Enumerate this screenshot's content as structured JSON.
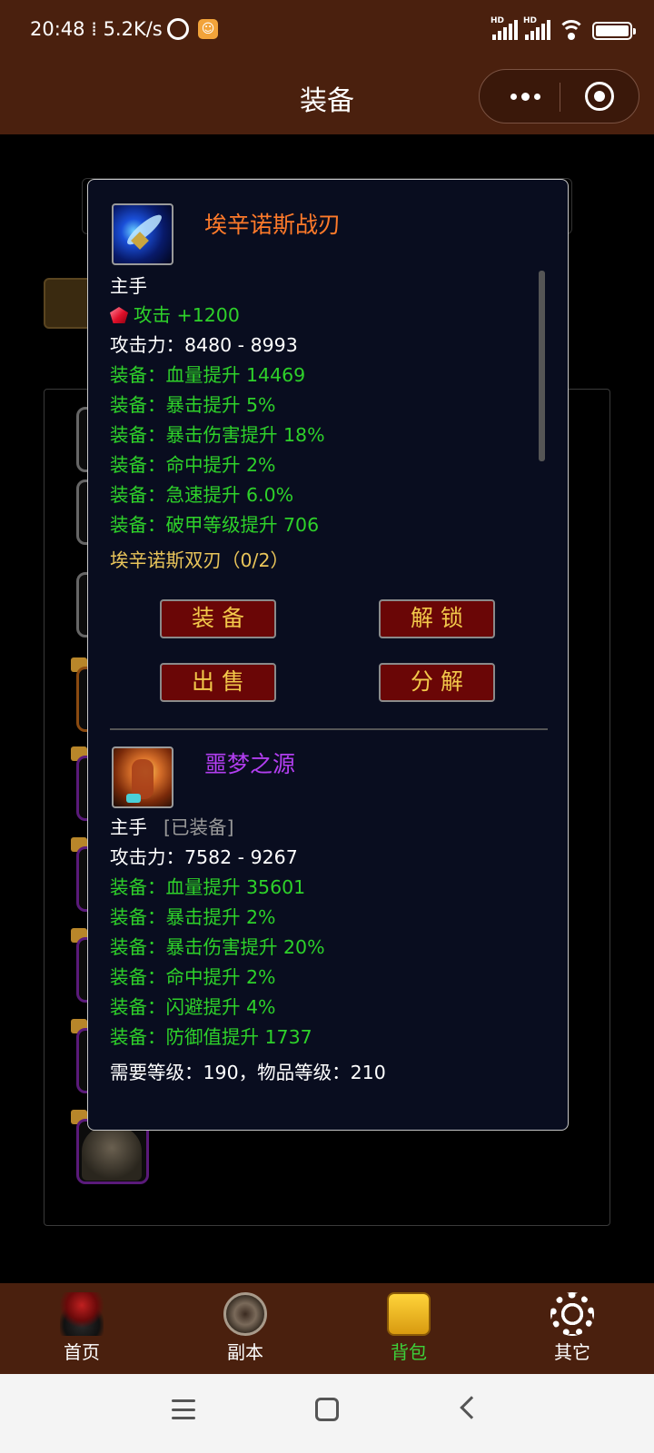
{
  "status_bar": {
    "time": "20:48",
    "speed": "5.2K/s",
    "hd1": "HD",
    "hd2": "HD"
  },
  "header": {
    "title": "装备"
  },
  "modal": {
    "item1": {
      "name": "埃辛诺斯战刃",
      "name_color": "#ff7a2a",
      "icon": "blade-icon",
      "slot": "主手",
      "gem": "攻击 +1200",
      "attack_label": "攻击力：",
      "attack_value": "8480 - 8993",
      "stats": [
        "装备：血量提升 14469",
        "装备：暴击提升 5%",
        "装备：暴击伤害提升 18%",
        "装备：命中提升 2%",
        "装备：急速提升 6.0%",
        "装备：破甲等级提升 706"
      ],
      "set_bonus": "埃辛诺斯双刃（0/2）"
    },
    "buttons": {
      "equip": "装备",
      "unlock": "解锁",
      "sell": "出售",
      "decompose": "分解"
    },
    "item2": {
      "name": "噩梦之源",
      "name_color": "#b23ef0",
      "icon": "fist-weapon-icon",
      "slot": "主手",
      "equipped_tag": "[已装备]",
      "attack_label": "攻击力：",
      "attack_value": "7582 - 9267",
      "stats": [
        "装备：血量提升 35601",
        "装备：暴击提升 2%",
        "装备：暴击伤害提升 20%",
        "装备：命中提升 2%",
        "装备：闪避提升 4%",
        "装备：防御值提升 1737"
      ],
      "requirements": "需要等级：190，物品等级：210"
    }
  },
  "tabbar": {
    "items": [
      {
        "label": "首页",
        "icon": "home-icon"
      },
      {
        "label": "副本",
        "icon": "dungeon-icon"
      },
      {
        "label": "背包",
        "icon": "bag-icon",
        "active": true
      },
      {
        "label": "其它",
        "icon": "gear-icon"
      }
    ],
    "active_color": "#3dd13a"
  },
  "colors": {
    "header_bg": "#4a200e",
    "modal_bg": "#090d1f",
    "stat_green": "#2ed12a",
    "set_gold": "#e8c45a",
    "button_bg": "#6a0606",
    "button_text": "#f2c84a"
  }
}
